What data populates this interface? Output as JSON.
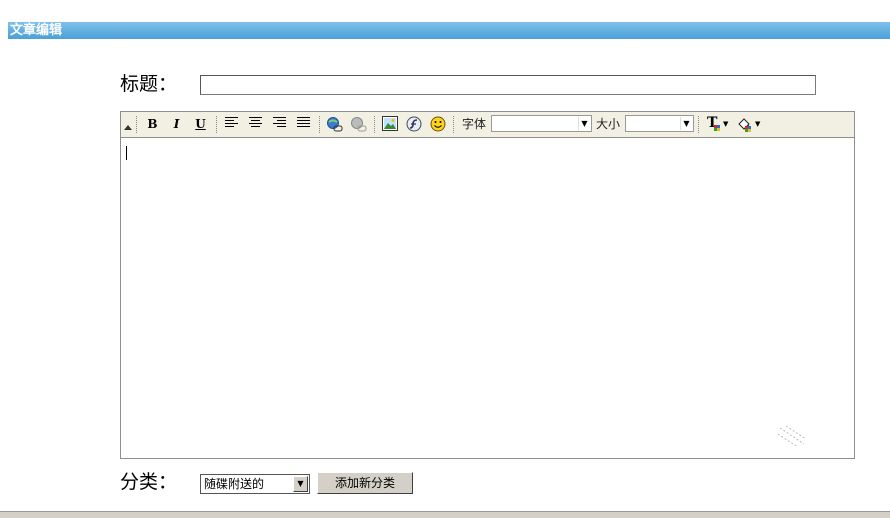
{
  "header": {
    "title": "文章编辑"
  },
  "form": {
    "title_label": "标题：",
    "title_value": "",
    "category_label": "分类：",
    "category_selected": "随碟附送的",
    "add_category_label": "添加新分类"
  },
  "toolbar": {
    "bold": "B",
    "italic": "I",
    "underline": "U",
    "font_label": "字体",
    "font_value": "",
    "size_label": "大小",
    "size_value": "",
    "text_color_glyph": "T"
  },
  "icons": {
    "align": [
      "align-left-icon",
      "align-center-icon",
      "align-right-icon",
      "align-justify-icon"
    ],
    "insert": [
      "link-icon",
      "unlink-icon",
      "image-icon",
      "flash-icon",
      "emoticon-icon"
    ],
    "color": [
      "text-color-icon",
      "background-color-icon"
    ]
  },
  "colors": {
    "header": "#4aa0d8",
    "toolbar": "#f1f0e3",
    "border": "#8e8e8e"
  }
}
